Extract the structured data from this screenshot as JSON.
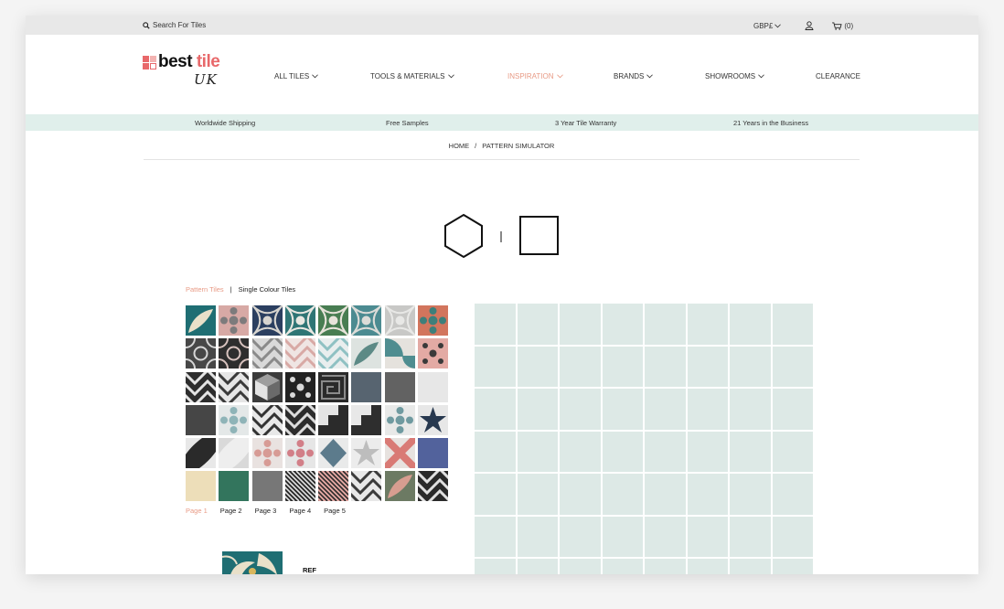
{
  "topbar": {
    "search_placeholder": "Search For Tiles",
    "currency": "GBP£",
    "cart_count": "(0)"
  },
  "logo": {
    "word_best": "best",
    "word_tile": "tile",
    "uk": "UK",
    "colors": [
      "#e8686a",
      "#f3b3b1",
      "#e8686a",
      "#111111"
    ]
  },
  "nav": {
    "items": [
      {
        "label": "ALL TILES",
        "dropdown": true
      },
      {
        "label": "TOOLS & MATERIALS",
        "dropdown": true
      },
      {
        "label": "INSPIRATION",
        "dropdown": true,
        "active": true
      },
      {
        "label": "BRANDS",
        "dropdown": true
      },
      {
        "label": "SHOWROOMS",
        "dropdown": true
      },
      {
        "label": "CLEARANCE",
        "dropdown": false
      }
    ],
    "active_color": "#e89a85"
  },
  "usps": [
    "Worldwide Shipping",
    "Free Samples",
    "3 Year Tile Warranty",
    "21 Years in the Business"
  ],
  "breadcrumb": {
    "home": "HOME",
    "separator": "/",
    "current": "PATTERN SIMULATOR"
  },
  "shape_toggle": {
    "options": [
      "hexagon-icon",
      "square-icon"
    ],
    "separator": "|"
  },
  "tile_tabs": {
    "pattern": "Pattern Tiles",
    "separator": "|",
    "single": "Single Colour Tiles"
  },
  "tiles": [
    {
      "bg": "#1f6e73",
      "fg": "#e9e0c9",
      "motif": "leaf"
    },
    {
      "bg": "#d7a9a5",
      "fg": "#7d7b7c",
      "motif": "flower"
    },
    {
      "bg": "#2b3f60",
      "fg": "#d8d5cf",
      "motif": "scale"
    },
    {
      "bg": "#2f7575",
      "fg": "#e9e7e1",
      "motif": "scale"
    },
    {
      "bg": "#487d52",
      "fg": "#e7e3da",
      "motif": "scale"
    },
    {
      "bg": "#4c8b91",
      "fg": "#dcdcd8",
      "motif": "scale"
    },
    {
      "bg": "#c8c8c6",
      "fg": "#e8e8e6",
      "motif": "scale"
    },
    {
      "bg": "#d2755d",
      "fg": "#3d7f7a",
      "motif": "flower"
    },
    {
      "bg": "#474747",
      "fg": "#d6d6d6",
      "motif": "circles"
    },
    {
      "bg": "#2e2e2e",
      "fg": "#d8c3bf",
      "motif": "circles"
    },
    {
      "bg": "#d9d9d9",
      "fg": "#8a8a8a",
      "motif": "chevron"
    },
    {
      "bg": "#efe5e3",
      "fg": "#d8a9a5",
      "motif": "chevron"
    },
    {
      "bg": "#e9eeee",
      "fg": "#8fc1c3",
      "motif": "chevron"
    },
    {
      "bg": "#dde3e0",
      "fg": "#5c8a86",
      "motif": "leaf"
    },
    {
      "bg": "#e5e2dd",
      "fg": "#4f8d90",
      "motif": "quarter"
    },
    {
      "bg": "#e3aaa4",
      "fg": "#3a3a3a",
      "motif": "dots"
    },
    {
      "bg": "#2d2d2d",
      "fg": "#e4e4e4",
      "motif": "chevron"
    },
    {
      "bg": "#e6e6e6",
      "fg": "#3a3a3a",
      "motif": "chevron"
    },
    {
      "bg": "#3b3b3b",
      "fg": "#9e9e9e",
      "motif": "cubes"
    },
    {
      "bg": "#222222",
      "fg": "#d9d9d9",
      "motif": "dots"
    },
    {
      "bg": "#2a2a2a",
      "fg": "#8a8a8a",
      "motif": "maze"
    },
    {
      "bg": "#4d5a66",
      "fg": "#6a7884",
      "motif": "plain"
    },
    {
      "bg": "#5e5e5e",
      "fg": "#6b6b6b",
      "motif": "plain"
    },
    {
      "bg": "#ececec",
      "fg": "#e0e0e0",
      "motif": "plain"
    },
    {
      "bg": "#3e3e3e",
      "fg": "#575757",
      "motif": "plain"
    },
    {
      "bg": "#e4e8e8",
      "fg": "#8fb4b8",
      "motif": "flower"
    },
    {
      "bg": "#e8e8e8",
      "fg": "#333333",
      "motif": "chevron"
    },
    {
      "bg": "#2c2c2c",
      "fg": "#dcdcdc",
      "motif": "chevron"
    },
    {
      "bg": "#e4e4e4",
      "fg": "#2b2b2b",
      "motif": "steps"
    },
    {
      "bg": "#e8e8e8",
      "fg": "#2e2e2e",
      "motif": "steps"
    },
    {
      "bg": "#e8e9e8",
      "fg": "#6f9aa0",
      "motif": "flower"
    },
    {
      "bg": "#e7e7e7",
      "fg": "#27384f",
      "motif": "star"
    },
    {
      "bg": "#2a2a2a",
      "fg": "#e8e8e8",
      "motif": "corner"
    },
    {
      "bg": "#eeeeee",
      "fg": "#d9d9d9",
      "motif": "corner"
    },
    {
      "bg": "#e9e2e0",
      "fg": "#d79b95",
      "motif": "flower"
    },
    {
      "bg": "#e6e6e6",
      "fg": "#d27f88",
      "motif": "flower"
    },
    {
      "bg": "#e9eaea",
      "fg": "#5c7b8c",
      "motif": "diamond"
    },
    {
      "bg": "#ececec",
      "fg": "#bdbdbd",
      "motif": "star"
    },
    {
      "bg": "#e7e2df",
      "fg": "#d97a75",
      "motif": "cross"
    },
    {
      "bg": "#4f5e98",
      "fg": "#5a69a2",
      "motif": "plain"
    },
    {
      "bg": "#ecdcb5",
      "fg": "#f1e3c0",
      "motif": "plain"
    },
    {
      "bg": "#2f7259",
      "fg": "#3b7c63",
      "motif": "plain"
    },
    {
      "bg": "#737373",
      "fg": "#7e7e7e",
      "motif": "plain"
    },
    {
      "bg": "#2a2a2a",
      "fg": "#e4e4e4",
      "motif": "diag"
    },
    {
      "bg": "#e5a9a4",
      "fg": "#2a2a2a",
      "motif": "diag"
    },
    {
      "bg": "#e8e8e8",
      "fg": "#3b3b3b",
      "motif": "chevron"
    },
    {
      "bg": "#6c7a63",
      "fg": "#d79d90",
      "motif": "leaf"
    },
    {
      "bg": "#2a2a2a",
      "fg": "#e0e0e0",
      "motif": "chevron"
    }
  ],
  "pagination": [
    "Page 1",
    "Page 2",
    "Page 3",
    "Page 4",
    "Page 5"
  ],
  "selected": {
    "ref_label": "REF"
  },
  "canvas": {
    "tile_color": "#dde9e6",
    "grout_color": "#ffffff"
  }
}
